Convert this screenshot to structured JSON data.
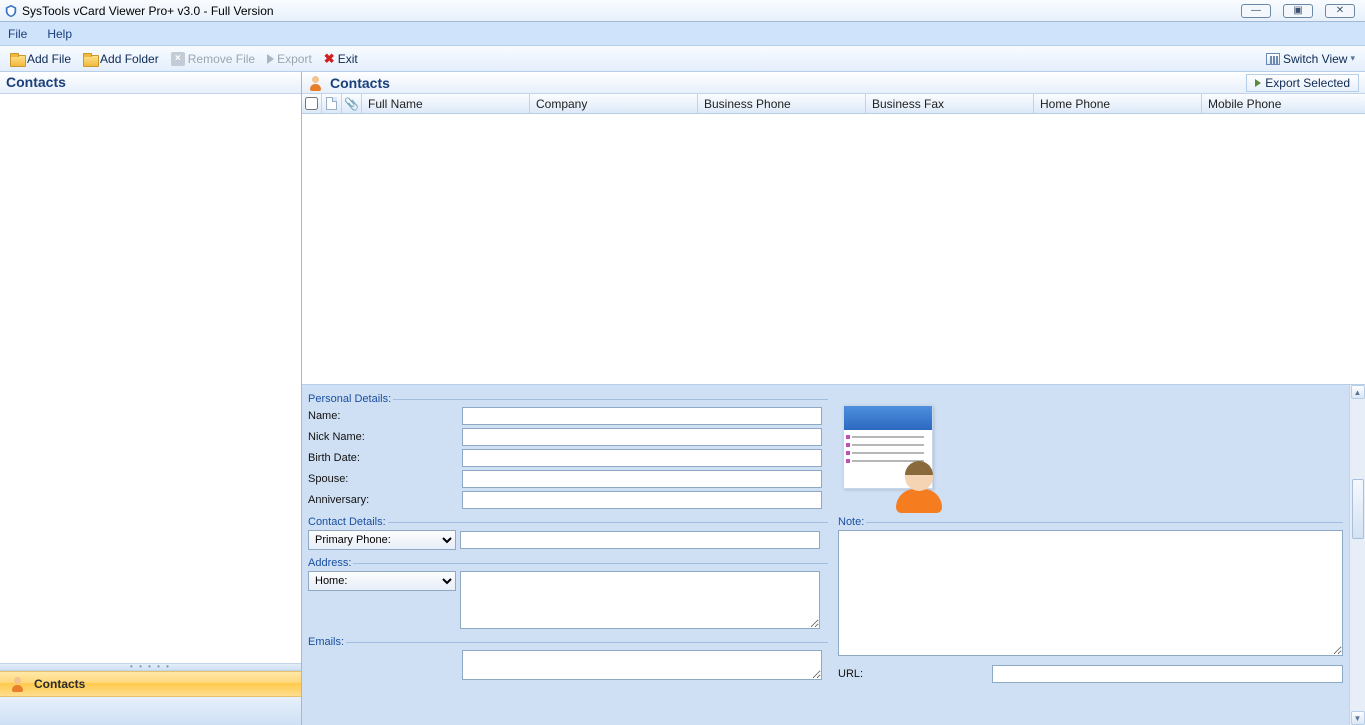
{
  "titlebar": {
    "title": "SysTools vCard Viewer Pro+ v3.0 - Full Version"
  },
  "menu": {
    "file": "File",
    "help": "Help"
  },
  "toolbar": {
    "add_file": "Add File",
    "add_folder": "Add Folder",
    "remove_file": "Remove File",
    "export": "Export",
    "exit": "Exit",
    "switch_view": "Switch View"
  },
  "left": {
    "header": "Contacts",
    "contacts_btn": "Contacts"
  },
  "right": {
    "header": "Contacts",
    "export_selected": "Export Selected"
  },
  "grid": {
    "cols": {
      "full_name": "Full Name",
      "company": "Company",
      "business_phone": "Business Phone",
      "business_fax": "Business Fax",
      "home_phone": "Home Phone",
      "mobile_phone": "Mobile Phone"
    }
  },
  "details": {
    "personal": {
      "legend": "Personal Details:",
      "name_lbl": "Name:",
      "nick_lbl": "Nick Name:",
      "birth_lbl": "Birth Date:",
      "spouse_lbl": "Spouse:",
      "anniv_lbl": "Anniversary:",
      "name": "",
      "nick": "",
      "birth": "",
      "spouse": "",
      "anniv": ""
    },
    "contact": {
      "legend": "Contact Details:",
      "primary_phone_sel": "Primary Phone:",
      "primary_phone_val": ""
    },
    "address": {
      "legend": "Address:",
      "home_sel": "Home:",
      "value": ""
    },
    "emails": {
      "legend": "Emails:",
      "value": ""
    },
    "note": {
      "legend": "Note:",
      "value": ""
    },
    "url": {
      "label": "URL:",
      "value": ""
    }
  }
}
